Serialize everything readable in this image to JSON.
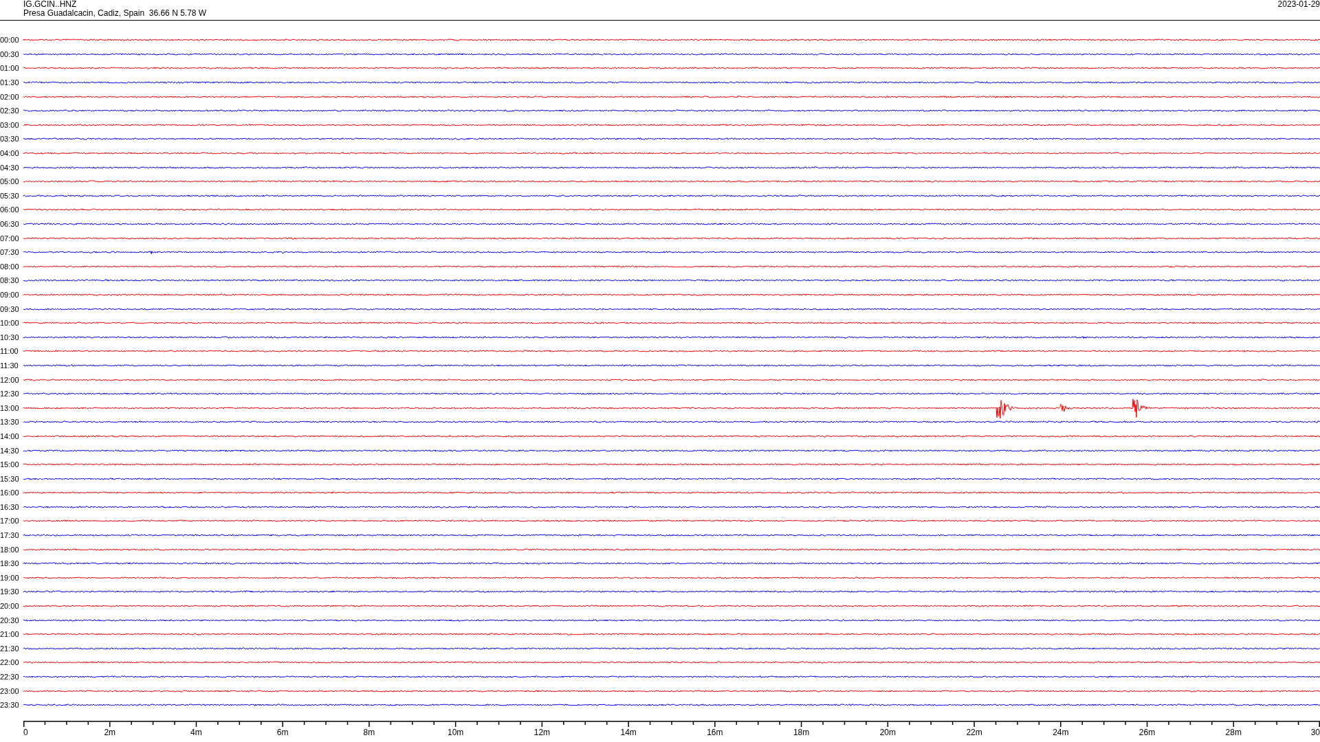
{
  "header": {
    "station": "IG.GCIN..HNZ",
    "location": "Presa Guadalcacin, Cadiz, Spain  36.66 N 5.78 W",
    "date": "2023-01-29"
  },
  "traces": [
    {
      "label": "00:00",
      "color": "#ff0000"
    },
    {
      "label": "00:30",
      "color": "#0000ff"
    },
    {
      "label": "01:00",
      "color": "#ff0000"
    },
    {
      "label": "01:30",
      "color": "#0000ff"
    },
    {
      "label": "02:00",
      "color": "#ff0000"
    },
    {
      "label": "02:30",
      "color": "#0000ff"
    },
    {
      "label": "03:00",
      "color": "#ff0000"
    },
    {
      "label": "03:30",
      "color": "#0000ff"
    },
    {
      "label": "04:00",
      "color": "#ff0000"
    },
    {
      "label": "04:30",
      "color": "#0000ff"
    },
    {
      "label": "05:00",
      "color": "#ff0000"
    },
    {
      "label": "05:30",
      "color": "#0000ff"
    },
    {
      "label": "06:00",
      "color": "#ff0000"
    },
    {
      "label": "06:30",
      "color": "#0000ff"
    },
    {
      "label": "07:00",
      "color": "#ff0000"
    },
    {
      "label": "07:30",
      "color": "#0000ff"
    },
    {
      "label": "08:00",
      "color": "#ff0000"
    },
    {
      "label": "08:30",
      "color": "#0000ff"
    },
    {
      "label": "09:00",
      "color": "#ff0000"
    },
    {
      "label": "09:30",
      "color": "#0000ff"
    },
    {
      "label": "10:00",
      "color": "#ff0000"
    },
    {
      "label": "10:30",
      "color": "#0000ff"
    },
    {
      "label": "11:00",
      "color": "#ff0000"
    },
    {
      "label": "11:30",
      "color": "#0000ff"
    },
    {
      "label": "12:00",
      "color": "#ff0000"
    },
    {
      "label": "12:30",
      "color": "#0000ff"
    },
    {
      "label": "13:00",
      "color": "#ff0000"
    },
    {
      "label": "13:30",
      "color": "#0000ff"
    },
    {
      "label": "14:00",
      "color": "#ff0000"
    },
    {
      "label": "14:30",
      "color": "#0000ff"
    },
    {
      "label": "15:00",
      "color": "#ff0000"
    },
    {
      "label": "15:30",
      "color": "#0000ff"
    },
    {
      "label": "16:00",
      "color": "#ff0000"
    },
    {
      "label": "16:30",
      "color": "#0000ff"
    },
    {
      "label": "17:00",
      "color": "#ff0000"
    },
    {
      "label": "17:30",
      "color": "#0000ff"
    },
    {
      "label": "18:00",
      "color": "#ff0000"
    },
    {
      "label": "18:30",
      "color": "#0000ff"
    },
    {
      "label": "19:00",
      "color": "#ff0000"
    },
    {
      "label": "19:30",
      "color": "#0000ff"
    },
    {
      "label": "20:00",
      "color": "#ff0000"
    },
    {
      "label": "20:30",
      "color": "#0000ff"
    },
    {
      "label": "21:00",
      "color": "#ff0000"
    },
    {
      "label": "21:30",
      "color": "#0000ff"
    },
    {
      "label": "22:00",
      "color": "#ff0000"
    },
    {
      "label": "22:30",
      "color": "#0000ff"
    },
    {
      "label": "23:00",
      "color": "#ff0000"
    },
    {
      "label": "23:30",
      "color": "#0000ff"
    }
  ],
  "time_axis": {
    "labels": [
      "0",
      "2m",
      "4m",
      "6m",
      "8m",
      "10m",
      "12m",
      "14m",
      "16m",
      "18m",
      "20m",
      "22m",
      "24m",
      "26m",
      "28m",
      "30"
    ]
  }
}
